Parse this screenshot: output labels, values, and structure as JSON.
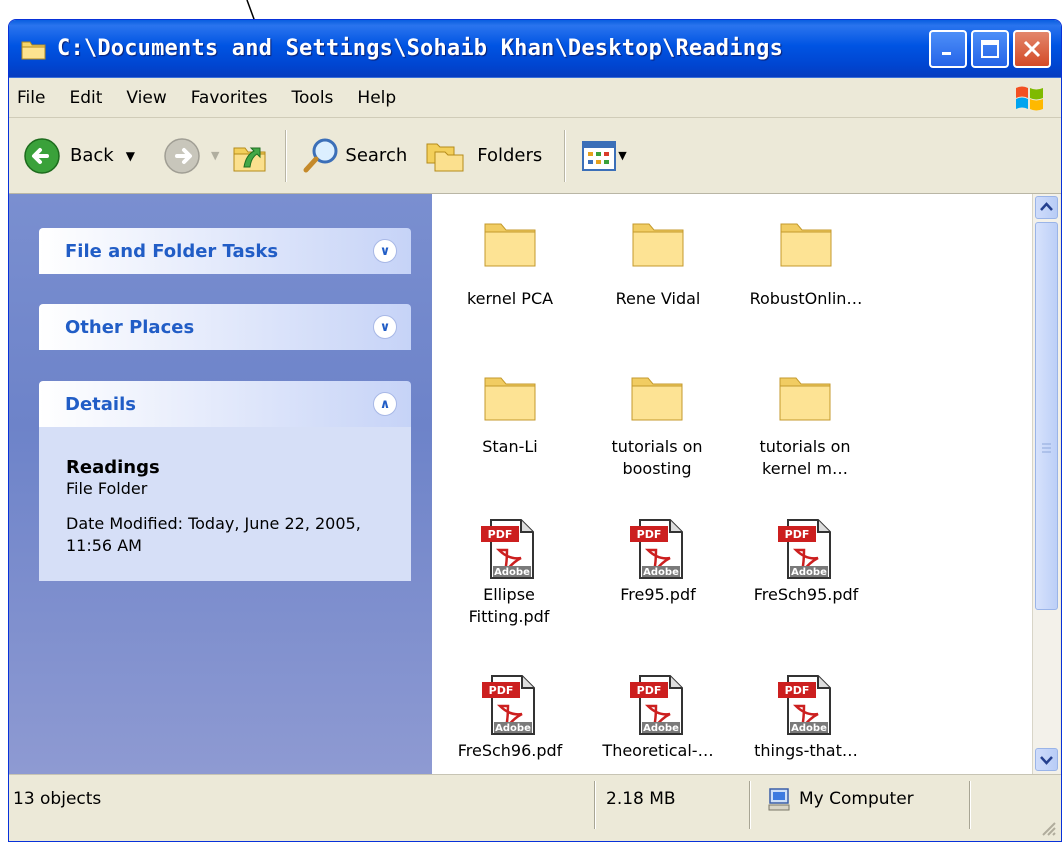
{
  "window": {
    "title": "C:\\Documents and Settings\\Sohaib Khan\\Desktop\\Readings"
  },
  "menu": [
    "File",
    "Edit",
    "View",
    "Favorites",
    "Tools",
    "Help"
  ],
  "toolbar": {
    "back_label": "Back",
    "search_label": "Search",
    "folders_label": "Folders"
  },
  "tasks": {
    "file_folder_tasks": "File and Folder Tasks",
    "other_places": "Other Places",
    "details": "Details",
    "details_name": "Readings",
    "details_type": "File Folder",
    "details_date": "Date Modified: Today, June 22, 2005, 11:56 AM"
  },
  "items": [
    {
      "label": "kernel PCA",
      "type": "folder"
    },
    {
      "label": "Rene Vidal",
      "type": "folder"
    },
    {
      "label": "RobustOnlin…",
      "type": "folder"
    },
    {
      "label": "Stan-Li",
      "type": "folder"
    },
    {
      "label": "tutorials on boosting",
      "type": "folder"
    },
    {
      "label": "tutorials on kernel m…",
      "type": "folder"
    },
    {
      "label": "Ellipse Fitting.pdf",
      "type": "pdf"
    },
    {
      "label": "Fre95.pdf",
      "type": "pdf"
    },
    {
      "label": "FreSch95.pdf",
      "type": "pdf"
    },
    {
      "label": "FreSch96.pdf",
      "type": "pdf"
    },
    {
      "label": "Theoretical-…",
      "type": "pdf"
    },
    {
      "label": "things-that…",
      "type": "pdf"
    }
  ],
  "pdf_icon": {
    "badge": "PDF",
    "brand": "Adobe"
  },
  "status": {
    "objects": "13 objects",
    "size": "2.18 MB",
    "location": "My Computer"
  },
  "colors": {
    "titlebar": "#0054e3",
    "task_pane": "#7a8fd0",
    "task_title": "#215dc6",
    "close_button": "#d34a27"
  }
}
